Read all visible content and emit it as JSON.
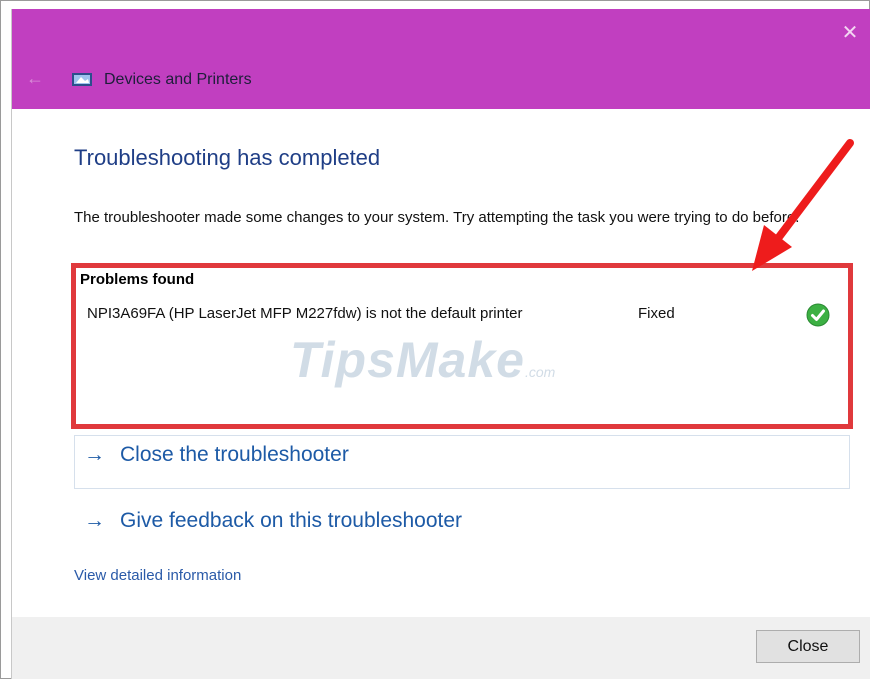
{
  "window": {
    "title": "Devices and Printers",
    "close_glyph": "✕",
    "back_glyph": "←"
  },
  "content": {
    "heading": "Troubleshooting has completed",
    "description": "The troubleshooter made some changes to your system. Try attempting the task you were trying to do before.",
    "problems": {
      "title": "Problems found",
      "items": [
        {
          "text": "NPI3A69FA (HP LaserJet MFP M227fdw) is not the default printer",
          "status": "Fixed",
          "icon": "green-check-icon"
        }
      ]
    },
    "links": {
      "close_troubleshooter": "Close the troubleshooter",
      "give_feedback": "Give feedback on this troubleshooter",
      "view_details": "View detailed information",
      "arrow_glyph": "→"
    }
  },
  "watermark": {
    "main": "TipsMake",
    "suffix": ".com"
  },
  "footer": {
    "close_button": "Close"
  },
  "colors": {
    "titlebar": "#c13fc0",
    "heading": "#1f3e86",
    "link": "#1d5aa6",
    "highlight": "#e0393c",
    "check": "#3cb043"
  }
}
